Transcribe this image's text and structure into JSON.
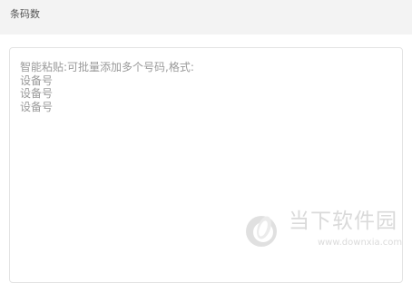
{
  "header": {
    "label": "条码数"
  },
  "input": {
    "placeholder": "智能粘贴:可批量添加多个号码,格式:\n设备号\n设备号\n设备号",
    "value": ""
  },
  "watermark": {
    "title": "当下软件园",
    "url": "www.downxia.com",
    "color": "#bdbdbd"
  }
}
